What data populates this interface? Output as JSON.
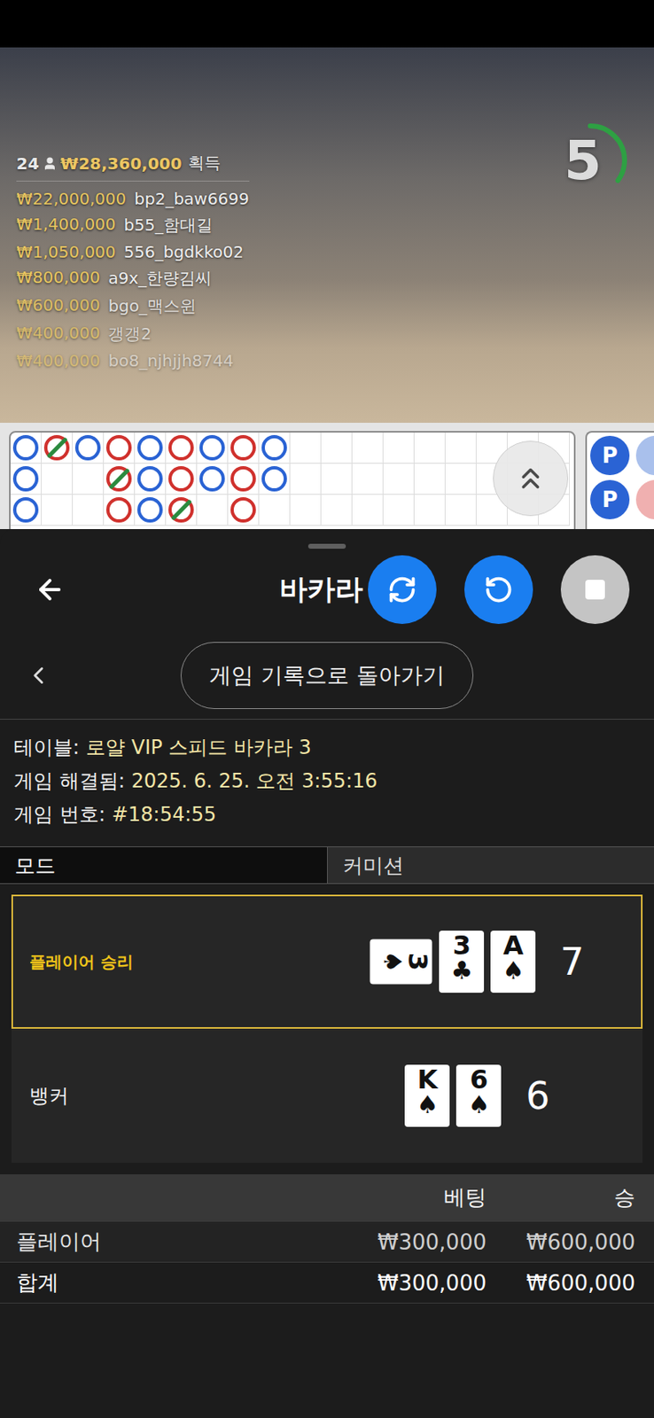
{
  "video": {
    "players": "24",
    "total": "₩28,360,000",
    "total_label": "획득",
    "winners": [
      {
        "amount": "₩22,000,000",
        "name": "bp2_baw6699"
      },
      {
        "amount": "₩1,400,000",
        "name": "b55_함대길"
      },
      {
        "amount": "₩1,050,000",
        "name": "556_bgdkko02"
      },
      {
        "amount": "₩800,000",
        "name": "a9x_한량김씨"
      },
      {
        "amount": "₩600,000",
        "name": "bgo_맥스윈"
      },
      {
        "amount": "₩400,000",
        "name": "갱갱2"
      },
      {
        "amount": "₩400,000",
        "name": "bo8_njhjjh8744"
      }
    ],
    "countdown": "5",
    "countdown_level": 0.35
  },
  "bead_road": {
    "columns": [
      [
        {
          "color": "#2a63d4",
          "tie": false
        },
        {
          "color": "#2a63d4",
          "tie": false
        },
        {
          "color": "#2a63d4",
          "tie": false
        }
      ],
      [
        {
          "color": "#d0312d",
          "tie": true
        },
        null,
        null
      ],
      [
        {
          "color": "#2a63d4",
          "tie": false
        },
        null,
        null
      ],
      [
        {
          "color": "#d0312d",
          "tie": false
        },
        {
          "color": "#d0312d",
          "tie": true
        },
        {
          "color": "#d0312d",
          "tie": false
        }
      ],
      [
        {
          "color": "#2a63d4",
          "tie": false
        },
        {
          "color": "#2a63d4",
          "tie": false
        },
        {
          "color": "#2a63d4",
          "tie": false
        }
      ],
      [
        {
          "color": "#d0312d",
          "tie": false
        },
        {
          "color": "#d0312d",
          "tie": false
        },
        {
          "color": "#d0312d",
          "tie": true
        }
      ],
      [
        {
          "color": "#2a63d4",
          "tie": false
        },
        {
          "color": "#2a63d4",
          "tie": false
        },
        null
      ],
      [
        {
          "color": "#d0312d",
          "tie": false
        },
        {
          "color": "#d0312d",
          "tie": false
        },
        {
          "color": "#d0312d",
          "tie": false
        }
      ],
      [
        {
          "color": "#2a63d4",
          "tie": false
        },
        {
          "color": "#2a63d4",
          "tie": false
        },
        null
      ],
      [
        null,
        null,
        null
      ],
      [
        null,
        null,
        null
      ],
      [
        null,
        null,
        null
      ],
      [
        null,
        null,
        null
      ],
      [
        null,
        null,
        null
      ],
      [
        null,
        null,
        null
      ],
      [
        null,
        null,
        null
      ],
      [
        null,
        null,
        null
      ],
      [
        null,
        null,
        null
      ]
    ]
  },
  "side_road": [
    {
      "label": "P",
      "color": "#2a63d4"
    },
    {
      "label": "P",
      "color": "#2a63d4"
    },
    {
      "label": "",
      "color": "#a9c0ec"
    },
    {
      "label": "",
      "color": "#f0b0b0"
    }
  ],
  "sheet": {
    "title": "바카라",
    "back_to_history": "게임 기록으로 돌아가기",
    "info": [
      {
        "label": "테이블:",
        "value": "로얄 VIP 스피드 바카라 3"
      },
      {
        "label": "게임 해결됨:",
        "value": "2025. 6. 25. 오전 3:55:16"
      },
      {
        "label": "게임 번호:",
        "value": "#18:54:55"
      }
    ],
    "tabs": [
      {
        "label": "모드",
        "selected": true
      },
      {
        "label": "커미션",
        "selected": false
      }
    ],
    "hands": [
      {
        "label": "플레이어 승리",
        "winner": true,
        "score": "7",
        "cards": [
          {
            "rank": "3",
            "suit": "♠",
            "sideways": true
          },
          {
            "rank": "3",
            "suit": "♣",
            "sideways": false
          },
          {
            "rank": "A",
            "suit": "♠",
            "sideways": false
          }
        ]
      },
      {
        "label": "뱅커",
        "winner": false,
        "score": "6",
        "cards": [
          {
            "rank": "K",
            "suit": "♠",
            "sideways": false
          },
          {
            "rank": "6",
            "suit": "♠",
            "sideways": false
          }
        ]
      }
    ],
    "bets": {
      "columns": [
        "베팅",
        "승"
      ],
      "rows": [
        {
          "name": "플레이어",
          "bet": "₩300,000",
          "win": "₩600,000",
          "total": false
        },
        {
          "name": "합계",
          "bet": "₩300,000",
          "win": "₩600,000",
          "total": true
        }
      ]
    }
  }
}
